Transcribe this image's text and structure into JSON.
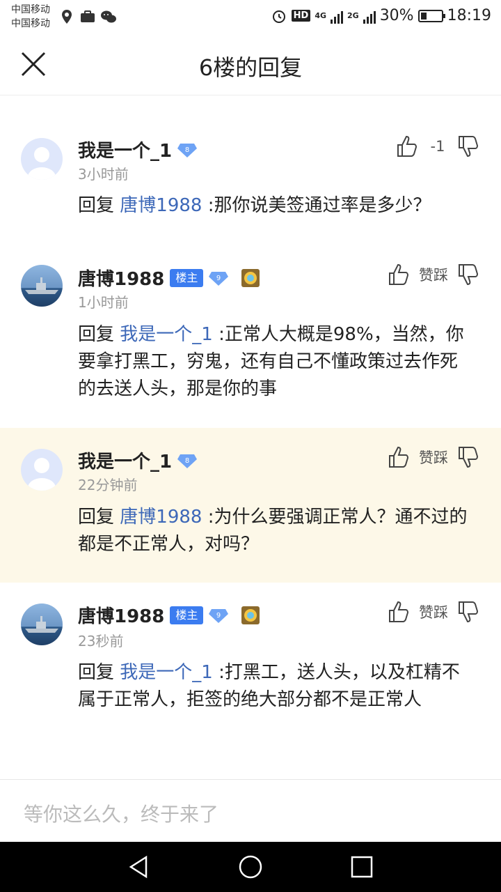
{
  "status": {
    "carrier1": "中国移动",
    "carrier2": "中国移动",
    "net1": "4G",
    "net2": "2G",
    "hd": "HD",
    "battery_pct": "30%",
    "battery_level": 0.3,
    "time": "18:19"
  },
  "header": {
    "title": "6楼的回复"
  },
  "posts": [
    {
      "user": "我是一个_1",
      "level": "8",
      "time": "3小时前",
      "reply_word": "回复",
      "mention": "唐博1988",
      "text": ":那你说美签通过率是多少？",
      "vote_label": "-1"
    },
    {
      "user": "唐博1988",
      "owner_tag": "楼主",
      "level": "9",
      "time": "1小时前",
      "reply_word": "回复",
      "mention": "我是一个_1",
      "text": ":正常人大概是98%，当然，你要拿打黑工，穷鬼，还有自己不懂政策过去作死的去送人头，那是你的事",
      "vote_label": "赞踩"
    },
    {
      "user": "我是一个_1",
      "level": "8",
      "time": "22分钟前",
      "reply_word": "回复",
      "mention": "唐博1988",
      "text": ":为什么要强调正常人？通不过的都是不正常人，对吗？",
      "vote_label": "赞踩"
    },
    {
      "user": "唐博1988",
      "owner_tag": "楼主",
      "level": "9",
      "time": "23秒前",
      "reply_word": "回复",
      "mention": "我是一个_1",
      "text": ":打黑工，送人头，以及杠精不属于正常人，拒签的绝大部分都不是正常人",
      "vote_label": "赞踩"
    }
  ],
  "input": {
    "placeholder": "等你这么久，终于来了"
  },
  "colors": {
    "mention": "#3d68b8",
    "owner_tag": "#3b7cf0",
    "highlight_bg": "#fdf8e8"
  }
}
